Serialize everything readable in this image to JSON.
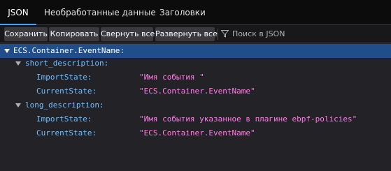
{
  "tabs": [
    {
      "label": "JSON",
      "active": true
    },
    {
      "label": "Необработанные данные",
      "active": false
    },
    {
      "label": "Заголовки",
      "active": false
    }
  ],
  "toolbar": {
    "save_label": "Сохранить",
    "copy_label": "Копировать",
    "collapse_label": "Свернуть все",
    "expand_label": "Развернуть все",
    "filter_placeholder": "Поиск в JSON"
  },
  "tree": {
    "root_key": "ECS.Container.EventName:",
    "short_description": {
      "key": "short_description:",
      "import_key": "ImportState:",
      "import_value": "\"Имя события \"",
      "current_key": "CurrentState:",
      "current_value": "\"ECS.Container.EventName\""
    },
    "long_description": {
      "key": "long_description:",
      "import_key": "ImportState:",
      "import_value": "\"Имя события указанное в плагине ebpf-policies\"",
      "current_key": "CurrentState:",
      "current_value": "\"ECS.Container.EventName\""
    }
  },
  "colors": {
    "accent": "#45a1ff",
    "selected_row": "#204e8a",
    "key": "#75bfff",
    "string_value": "#ff7de9"
  }
}
